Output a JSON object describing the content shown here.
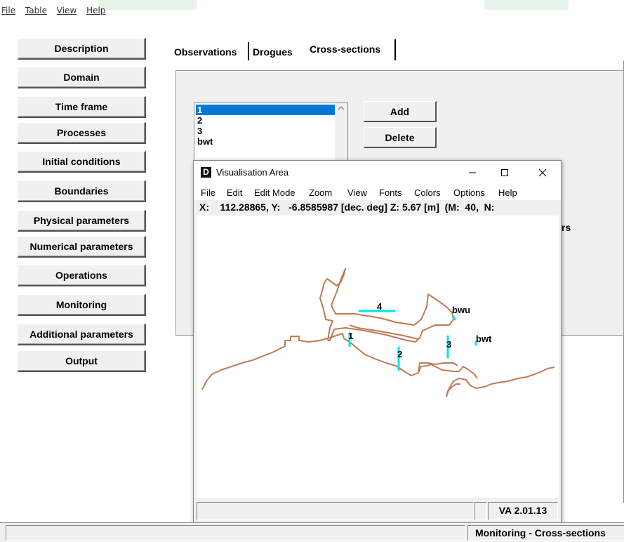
{
  "menubar": {
    "items": [
      "File",
      "Table",
      "View",
      "Help"
    ]
  },
  "sidebar": {
    "buttons": [
      "Description",
      "Domain",
      "Time frame",
      "Processes",
      "Initial conditions",
      "Boundaries",
      "Physical parameters",
      "Numerical parameters",
      "Operations",
      "Monitoring",
      "Additional parameters",
      "Output"
    ]
  },
  "tabs": {
    "items": [
      "Observations",
      "Drogues",
      "Cross-sections"
    ],
    "active": "Cross-sections"
  },
  "cross_sections": {
    "list": [
      "1",
      "2",
      "3",
      "bwt"
    ],
    "selected": "1",
    "add_label": "Add",
    "delete_label": "Delete",
    "partial_label": "rs"
  },
  "vis": {
    "title": "Visualisation Area",
    "logo": "D",
    "menu": [
      "File",
      "Edit",
      "Edit Mode",
      "Zoom",
      "View",
      "Fonts",
      "Colors",
      "Options",
      "Help"
    ],
    "coords": "X:    112.28865, Y:   -6.8585987 [dec. deg] Z: 5.67 [m]  (M:  40,  N:",
    "version": "VA 2.01.13",
    "labels": {
      "l1": "1",
      "l2": "2",
      "l3": "3",
      "l4": "4",
      "bwu": "bwu",
      "bwt": "bwt"
    },
    "coastline_color": "#c07a55",
    "section_color": "#00e5ee"
  },
  "statusbar": {
    "right": "Monitoring - Cross-sections"
  }
}
